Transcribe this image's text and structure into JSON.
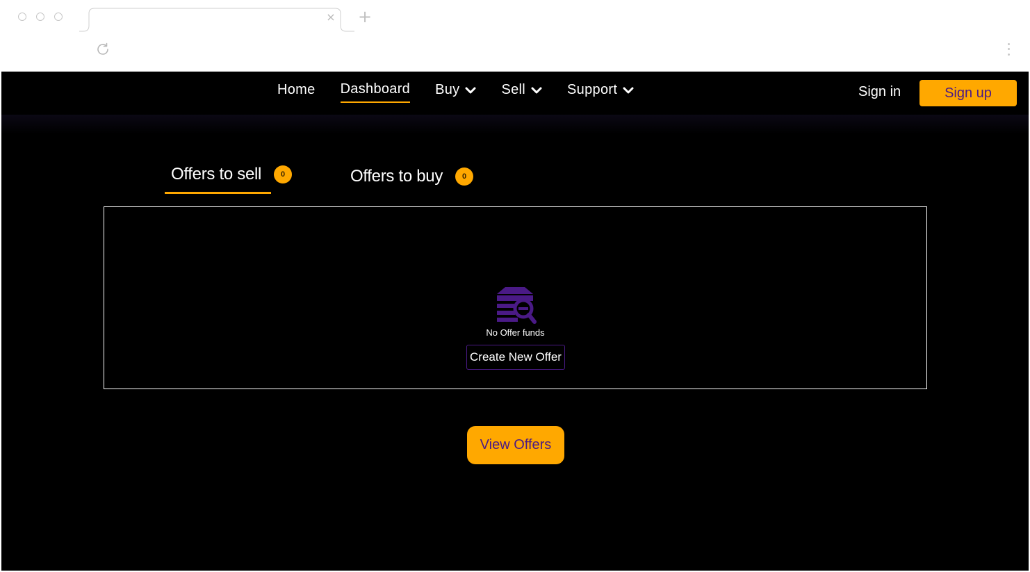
{
  "nav": {
    "links": [
      {
        "label": "Home"
      },
      {
        "label": "Dashboard"
      },
      {
        "label": "Buy"
      },
      {
        "label": "Sell"
      },
      {
        "label": "Support"
      }
    ],
    "sign_in": "Sign in",
    "sign_up": "Sign up"
  },
  "tabs": [
    {
      "label": "Offers to sell",
      "count": "0"
    },
    {
      "label": "Offers to buy",
      "count": "0"
    }
  ],
  "empty_state": {
    "icon": "no-offer-icon",
    "message": "No Offer funds",
    "create_button": "Create New Offer"
  },
  "view_offers_button": "View Offers",
  "colors": {
    "accent": "#ffa800",
    "brand_purple": "#4a1a86",
    "background": "#000000"
  }
}
